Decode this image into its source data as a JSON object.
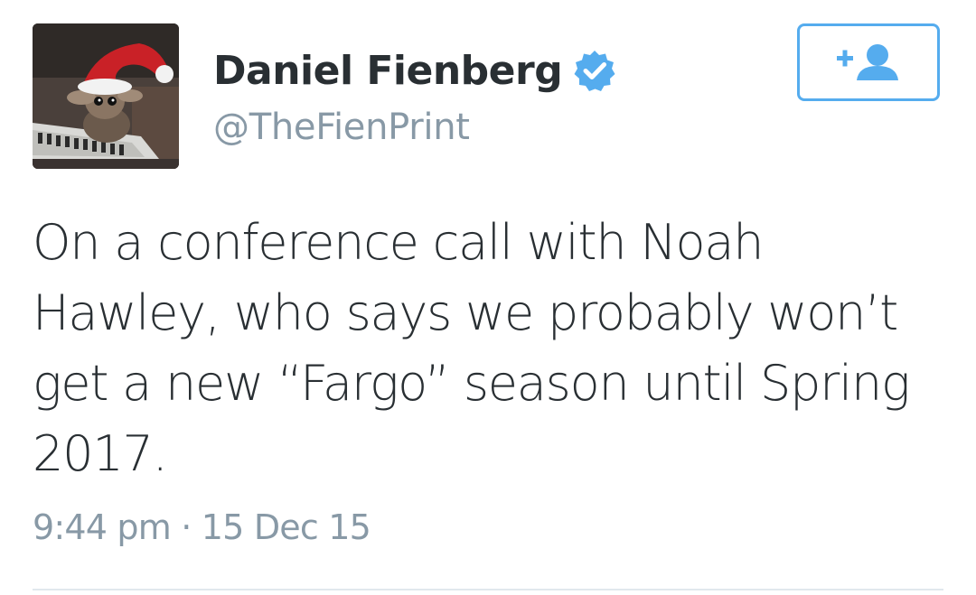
{
  "user": {
    "display_name": "Daniel Fienberg",
    "handle": "@TheFienPrint",
    "verified": true,
    "avatar_icon": "gremlin-santa-hat-keyboard-avatar"
  },
  "follow_button": {
    "icon": "add-user-icon",
    "color": "#55acee"
  },
  "tweet": {
    "text": "On a conference call with Noah\nHawley, who says we probably won’t\nget a new “Fargo” season until Spring\n2017.",
    "timestamp": "9:44 pm · 15 Dec 15"
  },
  "colors": {
    "accent": "#55acee",
    "text": "#292f33",
    "muted": "#8899a6",
    "divider": "#e1e8ed"
  }
}
